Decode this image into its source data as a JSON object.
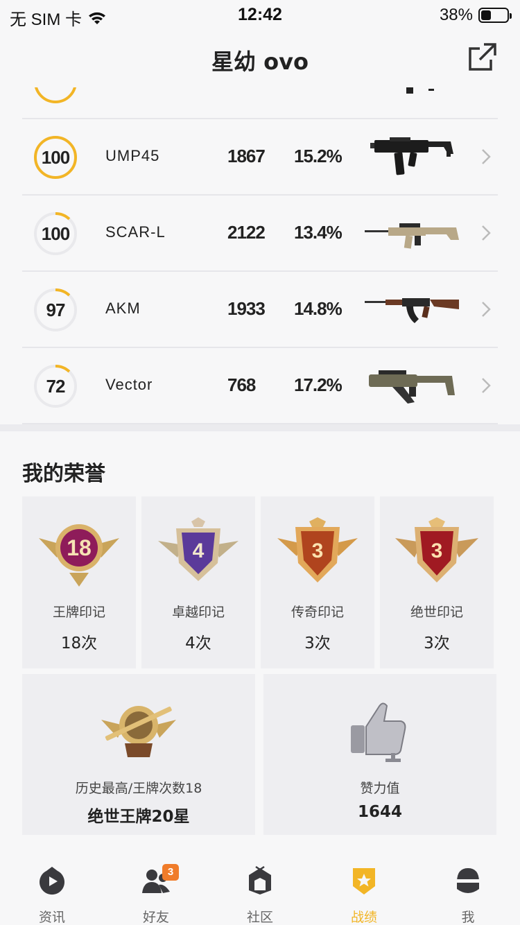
{
  "status_bar": {
    "carrier": "无 SIM 卡",
    "time": "12:42",
    "battery_text": "38%",
    "battery_level": 0.38
  },
  "nav": {
    "title": "星幼 ovo"
  },
  "weapons": [
    {
      "score": "100",
      "name": "UMP45",
      "kills": "1867",
      "rate": "15.2%",
      "ring_fill": 1.0,
      "ring_color": "#f2b526"
    },
    {
      "score": "100",
      "name": "SCAR-L",
      "kills": "2122",
      "rate": "13.4%",
      "ring_fill": 0.12,
      "ring_color": "#f2b526"
    },
    {
      "score": "97",
      "name": "AKM",
      "kills": "1933",
      "rate": "14.8%",
      "ring_fill": 0.12,
      "ring_color": "#f2b526"
    },
    {
      "score": "72",
      "name": "Vector",
      "kills": "768",
      "rate": "17.2%",
      "ring_fill": 0.12,
      "ring_color": "#f2b526"
    }
  ],
  "honors": {
    "title": "我的荣誉",
    "badges": [
      {
        "number": "18",
        "name": "王牌印记",
        "count": "18次",
        "icon": "ace-badge-icon"
      },
      {
        "number": "4",
        "name": "卓越印记",
        "count": "4次",
        "icon": "excellence-badge-icon"
      },
      {
        "number": "3",
        "name": "传奇印记",
        "count": "3次",
        "icon": "legend-badge-icon"
      },
      {
        "number": "3",
        "name": "绝世印记",
        "count": "3次",
        "icon": "peerless-badge-icon"
      }
    ],
    "best": {
      "label": "历史最高/王牌次数18",
      "value": "绝世王牌20星"
    },
    "likes": {
      "label": "赞力值",
      "value": "1644"
    }
  },
  "tabs": [
    {
      "label": "资讯",
      "icon": "news-icon",
      "active": false
    },
    {
      "label": "好友",
      "icon": "friends-icon",
      "active": false,
      "badge": "3"
    },
    {
      "label": "社区",
      "icon": "community-icon",
      "active": false
    },
    {
      "label": "战绩",
      "icon": "record-icon",
      "active": true
    },
    {
      "label": "我",
      "icon": "profile-icon",
      "active": false
    }
  ],
  "colors": {
    "accent": "#f2b526",
    "badge_orange": "#f07c2a"
  }
}
